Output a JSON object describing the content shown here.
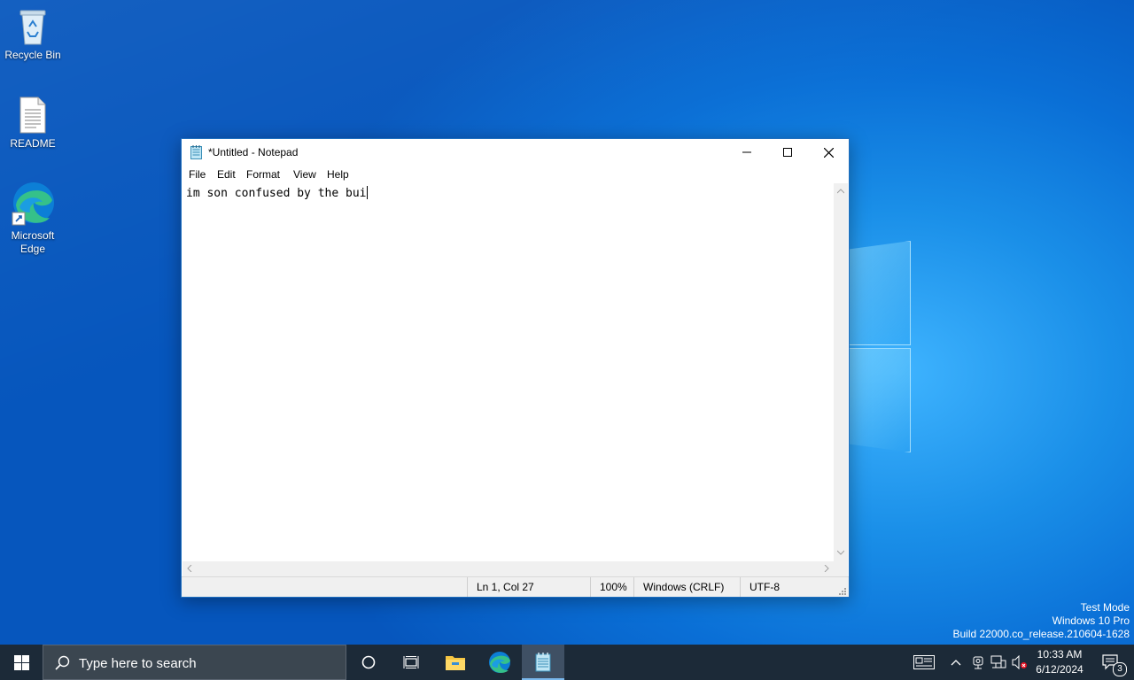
{
  "desktop": {
    "icons": [
      {
        "label": "Recycle Bin"
      },
      {
        "label": "README"
      },
      {
        "label": "Microsoft\nEdge"
      }
    ],
    "watermark": {
      "line1": "Test Mode",
      "line2": "Windows 10 Pro",
      "line3": "Build 22000.co_release.210604-1628"
    }
  },
  "notepad": {
    "title": "*Untitled - Notepad",
    "menu": [
      "File",
      "Edit",
      "Format",
      "View",
      "Help"
    ],
    "content": "im son confused by the bui",
    "status": {
      "position": "Ln 1, Col 27",
      "zoom": "100%",
      "line_ending": "Windows (CRLF)",
      "encoding": "UTF-8"
    }
  },
  "taskbar": {
    "search_placeholder": "Type here to search",
    "pinned": [
      "cortana-icon",
      "task-view-icon",
      "file-explorer-icon",
      "edge-icon",
      "notepad-icon"
    ],
    "clock": {
      "time": "10:33 AM",
      "date": "6/12/2024"
    },
    "notification_count": "3"
  },
  "colors": {
    "taskbar": "#1c2a38",
    "window_border": "#1f6fbf",
    "active_indicator": "#7ab8ec"
  }
}
